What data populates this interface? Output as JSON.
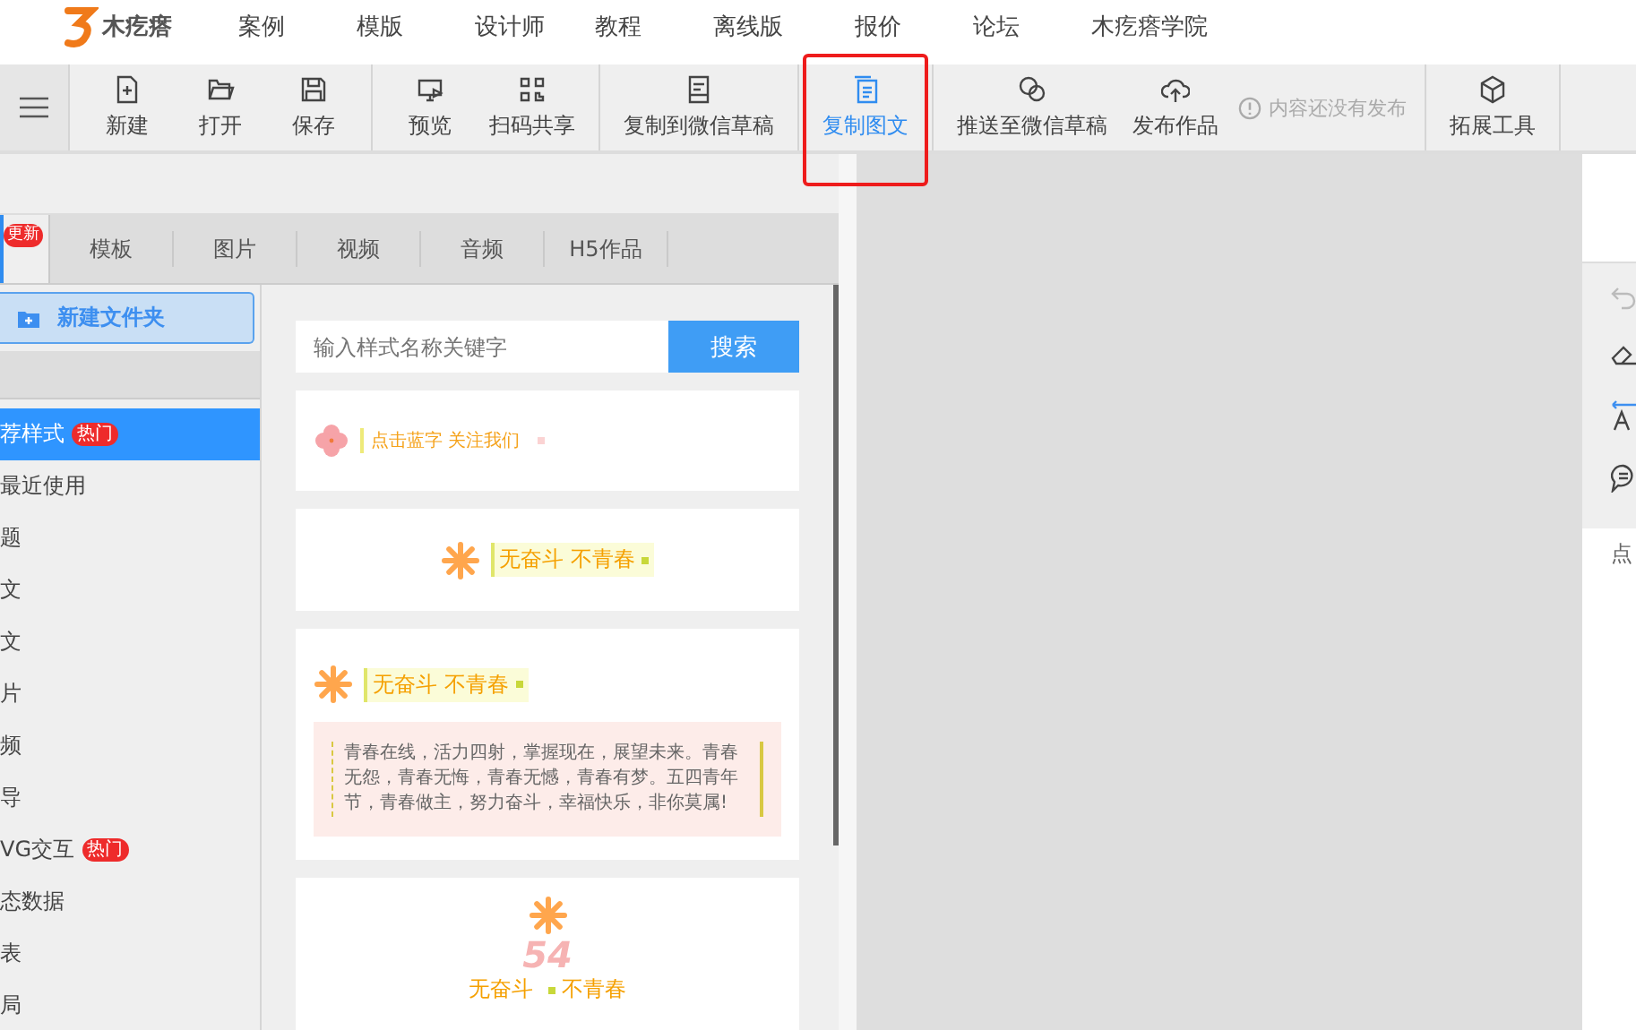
{
  "top_nav": {
    "logo_text": "木疙瘩",
    "items": [
      "案例",
      "模版",
      "设计师",
      "教程",
      "离线版",
      "报价",
      "论坛",
      "木疙瘩学院"
    ]
  },
  "toolbar": {
    "groups": [
      {
        "buttons": [
          {
            "label": "新建",
            "kind": "new",
            "selected": false
          },
          {
            "label": "打开",
            "kind": "open",
            "selected": false
          },
          {
            "label": "保存",
            "kind": "save",
            "selected": false
          }
        ]
      },
      {
        "buttons": [
          {
            "label": "预览",
            "kind": "preview",
            "selected": false
          },
          {
            "label": "扫码共享",
            "kind": "qr",
            "selected": false
          }
        ]
      },
      {
        "buttons": [
          {
            "label": "复制到微信草稿",
            "kind": "draft",
            "selected": false
          }
        ]
      },
      {
        "buttons": [
          {
            "label": "复制图文",
            "kind": "copy",
            "selected": true
          }
        ]
      },
      {
        "buttons": [
          {
            "label": "推送至微信草稿",
            "kind": "chat",
            "selected": false
          },
          {
            "label": "发布作品",
            "kind": "upload",
            "selected": false
          }
        ],
        "note": "内容还没有发布"
      },
      {
        "buttons": [
          {
            "label": "拓展工具",
            "kind": "cube",
            "selected": false
          }
        ]
      }
    ]
  },
  "tabs": [
    {
      "badge": "更新",
      "selected": true
    },
    {
      "label": "模板",
      "selected": false
    },
    {
      "label": "图片",
      "selected": false
    },
    {
      "label": "视频",
      "selected": false
    },
    {
      "label": "音频",
      "selected": false
    },
    {
      "label": "H5作品",
      "selected": false
    }
  ],
  "sidebar": {
    "new_folder": "新建文件夹",
    "items": [
      {
        "label": "荐样式",
        "badge": "热门",
        "selected": true
      },
      {
        "label": "最近使用",
        "selected": false
      },
      {
        "label": "题",
        "selected": false
      },
      {
        "label": "文",
        "selected": false
      },
      {
        "label": "文",
        "selected": false
      },
      {
        "label": "片",
        "selected": false
      },
      {
        "label": "频",
        "selected": false
      },
      {
        "label": "导",
        "selected": false
      },
      {
        "label": "VG交互",
        "badge": "热门",
        "selected": false
      },
      {
        "label": "态数据",
        "selected": false
      },
      {
        "label": "表",
        "selected": false
      },
      {
        "label": "局",
        "selected": false
      }
    ]
  },
  "search": {
    "placeholder": "输入样式名称关键字",
    "button": "搜索"
  },
  "styles": [
    {
      "kind": "follow",
      "title": "点击蓝字 关注我们"
    },
    {
      "kind": "banner",
      "title": "无奋斗 不青春"
    },
    {
      "kind": "paragraph",
      "title": "无奋斗 不青春",
      "body": "青春在线，活力四射，掌握现在，展望未来。青春无怨，青春无悔，青春无憾，青春有梦。五四青年节，青春做主，努力奋斗，幸福快乐，非你莫属!"
    },
    {
      "kind": "number",
      "number": "54",
      "left": "无奋斗",
      "right": "不青春"
    }
  ],
  "right_panel": {
    "footer": "点"
  }
}
